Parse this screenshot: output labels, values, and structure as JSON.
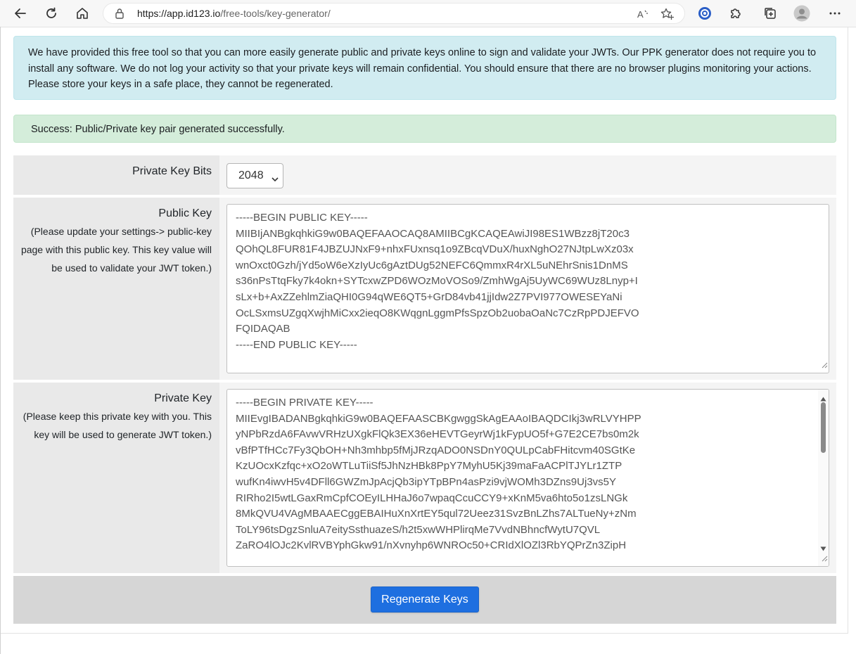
{
  "browser": {
    "url_host": "https://app.id123.io",
    "url_path": "/free-tools/key-generator/",
    "icons": [
      "back-icon",
      "refresh-icon",
      "home-icon",
      "lock-icon",
      "read-aloud-icon",
      "add-favorite-icon",
      "extension-app-icon",
      "extensions-icon",
      "collections-icon",
      "profile-icon",
      "more-icon"
    ]
  },
  "info_alert": {
    "text": "We have provided this free tool so that you can more easily generate public and private keys online to sign and validate your JWTs. Our PPK generator does not require you to install any software. We do not log your activity so that your private keys will remain confidential. You should ensure that there are no browser plugins monitoring your actions. Please store your keys in a safe place, they cannot be regenerated."
  },
  "success_alert": {
    "text": "Success: Public/Private key pair generated successfully."
  },
  "private_key_bits": {
    "label": "Private Key Bits",
    "selected": "2048"
  },
  "public_key": {
    "label": "Public Key",
    "note": "(Please update your settings-> public-key page with this public key. This key value will be used to validate your JWT token.)",
    "value": "-----BEGIN PUBLIC KEY-----\nMIIBIjANBgkqhkiG9w0BAQEFAAOCAQ8AMIIBCgKCAQEAwiJI98ES1WBzz8jT20c3\nQOhQL8FUR81F4JBZUJNxF9+nhxFUxnsq1o9ZBcqVDuX/huxNghO27NJtpLwXz03x\nwnOxct0Gzh/jYd5oW6eXzIyUc6gAztDUg52NEFC6QmmxR4rXL5uNEhrSnis1DnMS\ns36nPsTtqFky7k4okn+SYTcxwZPD6WOzMoVOSo9/ZmhWgAj5UyWC69WUz8Lnyp+I\nsLx+b+AxZZehlmZiaQHI0G94qWE6QT5+GrD84vb41jjIdw2Z7PVI977OWESEYaNi\nOcLSxmsUZgqXwjhMiCxx2ieqO8KWqgnLggmPfsSpzOb2uobaOaNc7CzRpPDJEFVO\nFQIDAQAB\n-----END PUBLIC KEY-----"
  },
  "private_key": {
    "label": "Private Key",
    "note": "(Please keep this private key with you. This key will be used to generate JWT token.)",
    "value": "-----BEGIN PRIVATE KEY-----\nMIIEvgIBADANBgkqhkiG9w0BAQEFAASCBKgwggSkAgEAAoIBAQDCIkj3wRLVYHPP\nyNPbRzdA6FAvwVRHzUXgkFlQk3EX36eHEVTGeyrWj1kFypUO5f+G7E2CE7bs0m2k\nvBfPTfHCc7Fy3QbOH+Nh3mhbp5fMjJRzqADO0NSDnY0QULpCabFHitcvm40SGtKe\nKzUOcxKzfqc+xO2oWTLuTiiSf5JhNzHBk8PpY7MyhU5Kj39maFaACPlTJYLr1ZTP\nwufKn4iwvH5v4DFll6GWZmJpAcjQb3ipYTpBPn4asPzi9vjWOMh3DZns9Uj3vs5Y\nRIRho2I5wtLGaxRmCpfCOEyILHHaJ6o7wpaqCcuCCY9+xKnM5va6hto5o1zsLNGk\n8MkQVU4VAgMBAAECggEBAIHuXnXrtEY5qul72Ueez31SvzBnLZhs7ALTueNy+zNm\nToLY96tsDgzSnluA7eitySsthuazeS/h2t5xwWHPlirqMe7VvdNBhncfWytU7QVL\nZaRO4lOJc2KvlRVBYphGkw91/nXvnyhp6WNROc50+CRIdXlOZl3RbYQPrZn3ZipH"
  },
  "regenerate_button": {
    "label": "Regenerate Keys"
  }
}
